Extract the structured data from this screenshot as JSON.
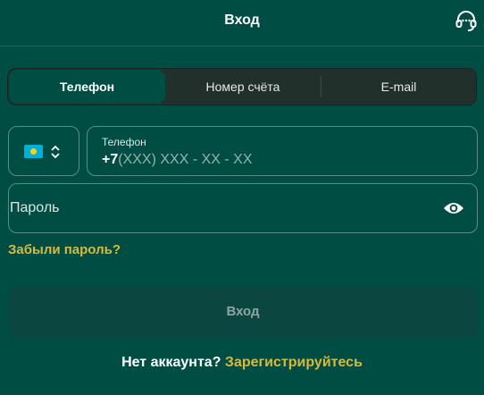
{
  "header": {
    "title": "Вход",
    "support_icon": "headset-icon"
  },
  "tabs": [
    {
      "label": "Телефон",
      "active": true
    },
    {
      "label": "Номер счёта",
      "active": false
    },
    {
      "label": "E-mail",
      "active": false
    }
  ],
  "phone": {
    "country_flag": "kazakhstan-flag-icon",
    "label": "Телефон",
    "prefix": "+7",
    "mask": "(XXX) XXX - XX - XX"
  },
  "password": {
    "placeholder": "Пароль",
    "toggle_icon": "eye-icon"
  },
  "forgot_label": "Забыли пароль?",
  "login_button": "Вход",
  "signup": {
    "question": "Нет аккаунта?",
    "link": "Зарегистрируйтесь"
  },
  "colors": {
    "background": "#004d43",
    "accent": "#d9b93a",
    "tabs_bg": "#22302c"
  }
}
